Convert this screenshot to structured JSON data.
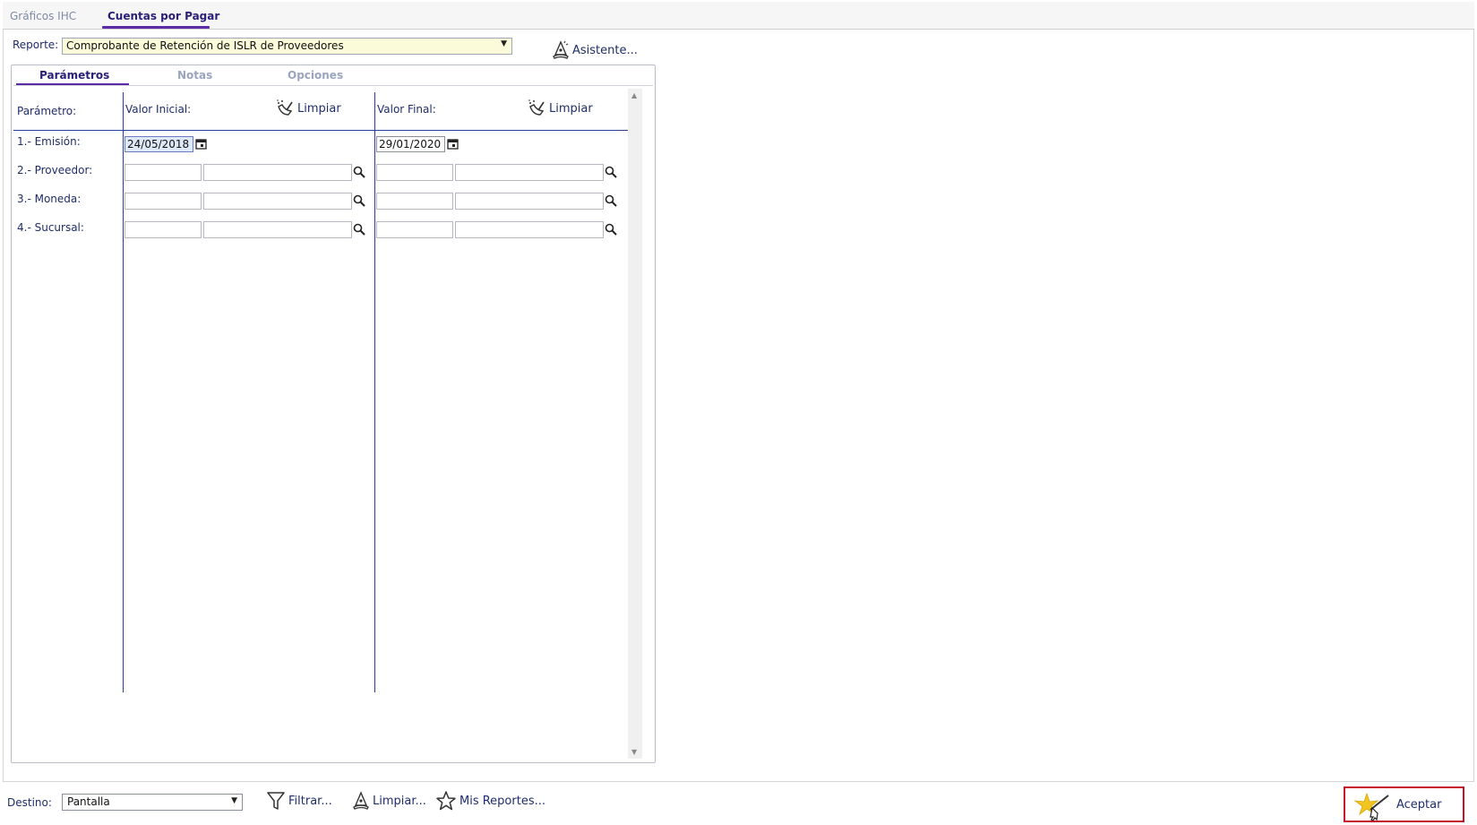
{
  "tabs": {
    "items": [
      {
        "label": "Gráficos IHC",
        "active": false
      },
      {
        "label": "Cuentas por Pagar",
        "active": true
      }
    ]
  },
  "report": {
    "label": "Reporte:",
    "selected": "Comprobante de Retención de ISLR de Proveedores",
    "wizard_label": "Asistente..."
  },
  "panel_tabs": {
    "items": [
      {
        "label": "Parámetros",
        "active": true
      },
      {
        "label": "Notas",
        "active": false
      },
      {
        "label": "Opciones",
        "active": false
      }
    ]
  },
  "params": {
    "header_param": "Parámetro:",
    "header_initial": "Valor Inicial:",
    "header_final": "Valor Final:",
    "clear_label": "Limpiar",
    "rows": [
      {
        "label": "1.- Emisión:",
        "initial": "24/05/2018",
        "final": "29/01/2020"
      },
      {
        "label": "2.- Proveedor:"
      },
      {
        "label": "3.- Moneda:"
      },
      {
        "label": "4.- Sucursal:"
      }
    ]
  },
  "bottom": {
    "dest_label": "Destino:",
    "dest_selected": "Pantalla",
    "filter_label": "Filtrar...",
    "clear_label": "Limpiar...",
    "my_reports_label": "Mis Reportes...",
    "accept_label": "Aceptar"
  },
  "colors": {
    "accent": "#5b2ba8",
    "text": "#1f2d6b",
    "highlight_border": "#c8112a",
    "select_bg": "#fbfbd9"
  }
}
